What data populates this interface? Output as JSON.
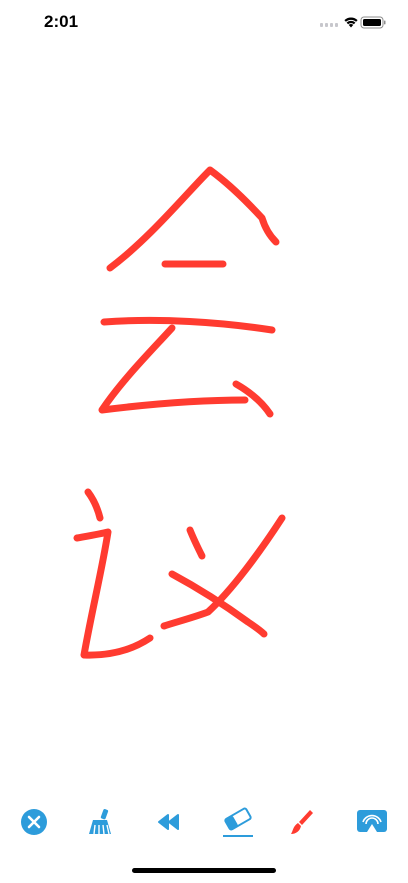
{
  "status_bar": {
    "time": "2:01"
  },
  "canvas": {
    "stroke_color": "#FF3B30",
    "drawing": "handwritten-characters"
  },
  "toolbar": {
    "accent_color": "#2D9CDB",
    "brush_color": "#FF3B30",
    "tools": [
      {
        "name": "close",
        "icon": "close-circle-icon"
      },
      {
        "name": "clear",
        "icon": "broom-icon"
      },
      {
        "name": "undo",
        "icon": "rewind-icon"
      },
      {
        "name": "eraser",
        "icon": "eraser-icon"
      },
      {
        "name": "brush",
        "icon": "brush-icon"
      },
      {
        "name": "airplay",
        "icon": "airplay-icon"
      }
    ]
  }
}
